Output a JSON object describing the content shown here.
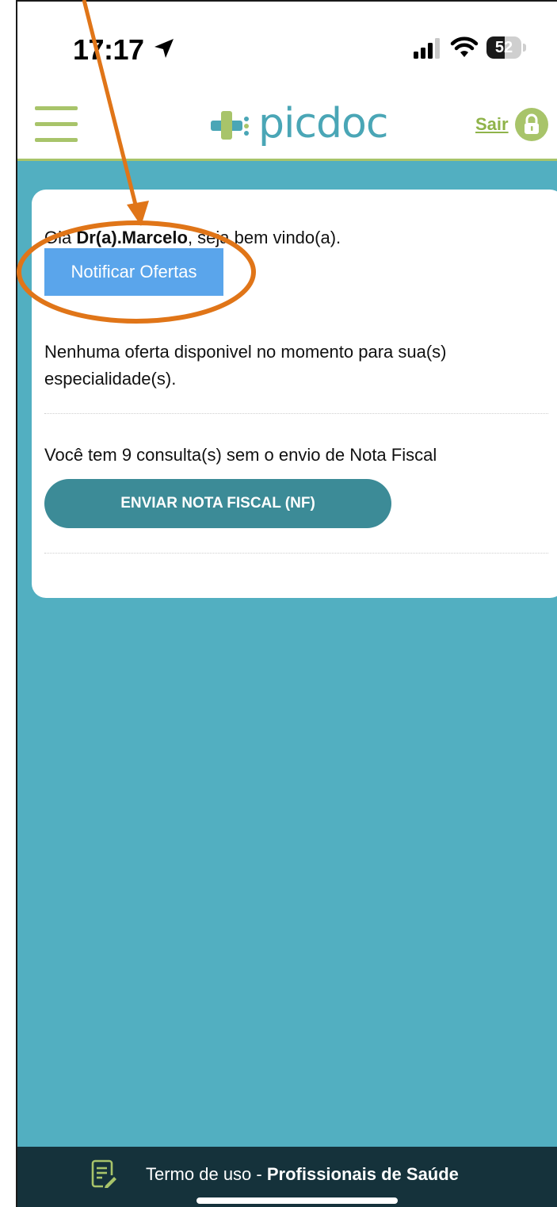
{
  "status_bar": {
    "time": "17:17",
    "battery": "52",
    "battery_level": 0.52
  },
  "header": {
    "logo_text": "picdoc",
    "logout_label": "Sair"
  },
  "card": {
    "greeting_prefix": "Olá ",
    "doctor_name": "Dr(a).Marcelo",
    "greeting_suffix": ", seja bem vindo(a).",
    "notify_button": "Notificar Ofertas",
    "no_offers_text": "Nenhuma oferta disponivel no momento para sua(s) especialidade(s).",
    "pending_text": "Você tem 9 consulta(s) sem o envio de Nota Fiscal",
    "nf_button": "ENVIAR NOTA FISCAL (NF)"
  },
  "footer": {
    "terms_prefix": "Termo de uso - ",
    "terms_audience": "Profissionais de Saúde"
  },
  "colors": {
    "main_background": "#52afc1",
    "brand_green": "#a8c46a",
    "brand_teal": "#4aa6b6",
    "notify_button": "#5aa5eb",
    "nf_button": "#3c8b97",
    "footer": "#15323b",
    "annotation": "#e07518"
  },
  "icons": [
    "location-arrow-icon",
    "signal-icon",
    "wifi-icon",
    "battery-icon",
    "menu-icon",
    "logo-cross-icon",
    "lock-icon",
    "document-edit-icon"
  ]
}
